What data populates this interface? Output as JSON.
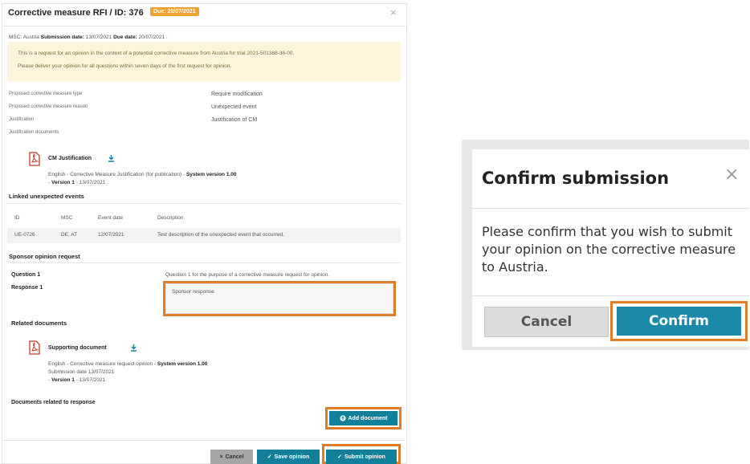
{
  "modal": {
    "title": "Corrective measure RFI / ID: 376",
    "due_badge": "Due: 20/07/2021",
    "msc_line_a": "MSC: Austria",
    "submission_label": "Submission date:",
    "submission_value": "13/07/2021",
    "due_label": "Due date:",
    "due_value": "20/07/2021 :",
    "info_line1": "This is a request for an opinion in the context of a potential corrective measure from Austria for trial 2021-501388-36-00.",
    "info_line2": "Please deliver your opinion for all questions within seven days of the first request for opinion.",
    "fields": [
      {
        "label": "Proposed corrective measure type",
        "value": "Require modification"
      },
      {
        "label": "Proposed corrective measure reason",
        "value": "Unexpected event"
      },
      {
        "label": "Justification",
        "value": "Justification of CM"
      },
      {
        "label": "Justification documents",
        "value": ""
      }
    ],
    "cm_doc": {
      "name": "CM Justification",
      "meta_prefix": "English - Corrective Measure Justification (for publication) -",
      "system_version": "System version 1.00",
      "version_label": "Version 1",
      "version_rest": "- 13/07/2021"
    },
    "linked_title": "Linked unexpected events",
    "table": {
      "headers": [
        "ID",
        "MSC",
        "Event date",
        "Description"
      ],
      "rows": [
        [
          "UE-0726",
          "DE, AT",
          "12/07/2021",
          "Test description of the unexpected event that occurred."
        ]
      ]
    },
    "sponsor_title": "Sponsor opinion request",
    "question_label": "Question 1",
    "question_text": "Question 1 for the purpose of a corrective measure request for opinion.",
    "response_label": "Response 1",
    "response_value": "Sponsor response",
    "related_title": "Related documents",
    "support_doc": {
      "name": "Supporting document",
      "meta_prefix": "English - Corrective measure request opinion -",
      "system_version": "System version 1.00",
      "submission_line": "Submission date 13/07/2021",
      "version_label": "Version 1",
      "version_rest": "- 13/07/2021"
    },
    "docs_response_title": "Documents related to response",
    "add_document": "Add document",
    "cancel": "Cancel",
    "save_opinion": "Save opinion",
    "submit_opinion": "Submit opinion"
  },
  "dialog": {
    "title": "Confirm submission",
    "body": "Please confirm that you wish to submit your opinion on the corrective measure to Austria.",
    "cancel": "Cancel",
    "confirm": "Confirm"
  },
  "colors": {
    "accent": "#13809b",
    "highlight": "#e07d2a",
    "badge": "#f0a030",
    "info_bg": "#fcf5dc",
    "pdf_red": "#c0392b"
  },
  "icons": [
    "close-icon",
    "pdf-icon",
    "download-icon",
    "upload-icon",
    "check-icon",
    "cross-icon"
  ]
}
